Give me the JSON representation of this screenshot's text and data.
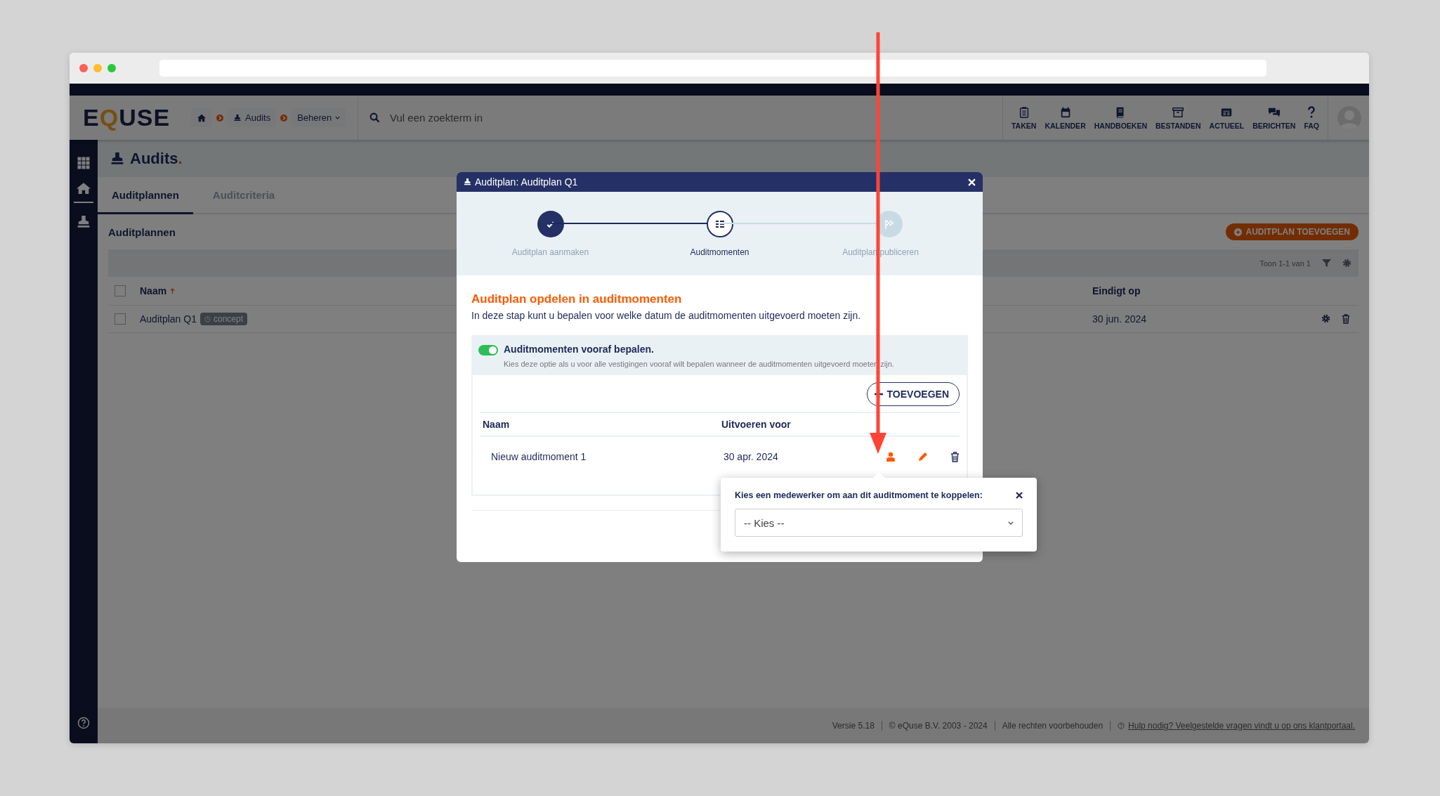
{
  "header": {
    "logo": "EQUSE",
    "breadcrumbs": [
      {
        "kind": "home"
      },
      {
        "kind": "link",
        "label": "Audits"
      },
      {
        "kind": "dropdown",
        "label": "Beheren"
      }
    ],
    "search": {
      "placeholder": "Vul een zoekterm in"
    },
    "nav": [
      {
        "kind": "clipboard",
        "label": "TAKEN"
      },
      {
        "kind": "calendar",
        "label": "KALENDER"
      },
      {
        "kind": "book",
        "label": "HANDBOEKEN"
      },
      {
        "kind": "archive",
        "label": "BESTANDEN"
      },
      {
        "kind": "news",
        "label": "ACTUEEL"
      },
      {
        "kind": "chat",
        "label": "BERICHTEN"
      },
      {
        "kind": "question",
        "label": "FAQ"
      }
    ]
  },
  "sidebar": {
    "items": [
      {
        "kind": "apps"
      },
      {
        "kind": "home"
      },
      {
        "kind": "stamp"
      }
    ]
  },
  "page": {
    "title": "Audits."
  },
  "tabs": [
    {
      "label": "Auditplannen",
      "selected": true
    },
    {
      "label": "Auditcriteria",
      "selected": false
    }
  ],
  "section": {
    "title": "Auditplannen",
    "add_button": "AUDITPLAN TOEVOEGEN",
    "count": "Toon 1-1 van 1"
  },
  "table": {
    "header_checked": false,
    "columns": [
      {
        "label": "Naam",
        "sorted": true
      },
      {
        "label": "Eindigt op",
        "sorted": false
      }
    ],
    "rows": [
      {
        "checked": false,
        "name": "Auditplan Q1",
        "badge": "concept",
        "end": "30 jun. 2024"
      }
    ]
  },
  "modal": {
    "title": "Auditplan: Auditplan Q1",
    "steps": [
      {
        "label": "Auditplan aanmaken",
        "completed": true,
        "selected": false
      },
      {
        "label": "Auditmomenten",
        "completed": false,
        "selected": true
      },
      {
        "label": "Auditplan publiceren",
        "completed": false,
        "selected": false
      }
    ],
    "heading": "Auditplan opdelen in auditmomenten",
    "description": "In deze stap kunt u bepalen voor welke datum de auditmomenten uitgevoerd moeten zijn.",
    "toggle": {
      "on": true,
      "label": "Auditmomenten vooraf bepalen.",
      "hint": "Kies deze optie als u voor alle vestigingen vooraf wilt bepalen wanneer de auditmomenten uitgevoerd moeten zijn."
    },
    "add_button": "TOEVOEGEN",
    "columns": [
      "Naam",
      "Uitvoeren voor"
    ],
    "rows": [
      {
        "name": "Nieuw auditmoment 1",
        "date": "30 apr. 2024"
      }
    ]
  },
  "popup": {
    "title": "Kies een medewerker om aan dit auditmoment te koppelen:",
    "select_value": "-- Kies --"
  },
  "footer": {
    "items": [
      "Versie 5.18",
      "© eQuse B.V. 2003 - 2024",
      "Alle rechten voorbehouden"
    ],
    "help_link": "Hulp nodig? Veelgestelde vragen vindt u op ons klantportaal."
  }
}
